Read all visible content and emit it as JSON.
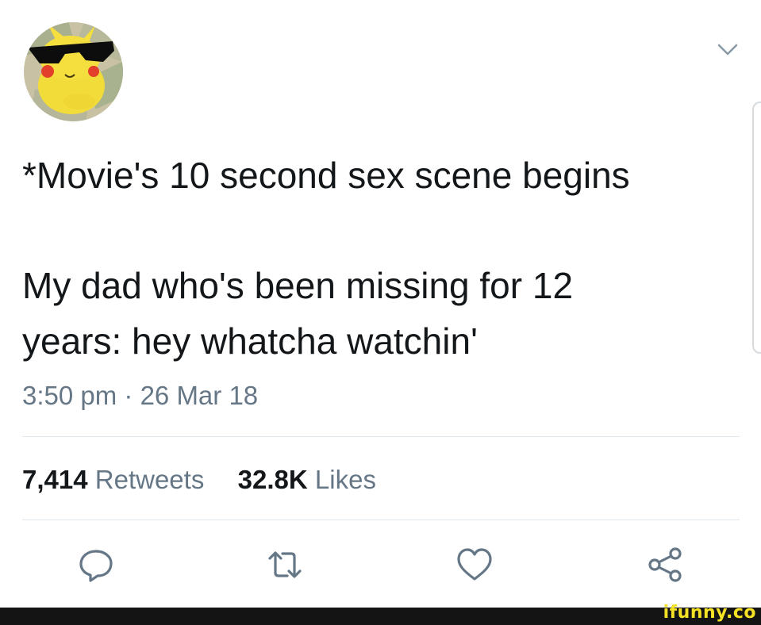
{
  "tweet": {
    "line1": "*Movie's 10 second sex scene begins",
    "line2": "My dad who's been missing for 12",
    "line3": "years: hey whatcha watchin'",
    "timestamp": "3:50 pm · 26 Mar 18"
  },
  "stats": {
    "retweets_count": "7,414",
    "retweets_label": "Retweets",
    "likes_count": "32.8K",
    "likes_label": "Likes"
  },
  "icons": {
    "menu": "chevron-down-icon",
    "reply": "reply-icon",
    "retweet": "retweet-icon",
    "like": "heart-icon",
    "share": "share-icon"
  },
  "colors": {
    "text": "#14171a",
    "muted": "#657786",
    "divider": "#e1e8ed",
    "watermark": "#f6e225"
  },
  "watermark": "ifunny.co"
}
